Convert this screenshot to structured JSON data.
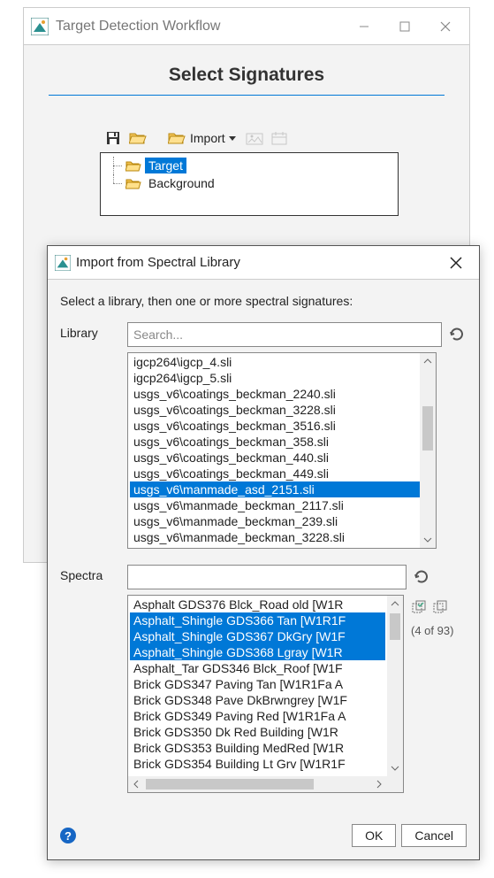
{
  "parentWindow": {
    "title": "Target Detection Workflow",
    "heading": "Select Signatures",
    "toolbar": {
      "import_label": "Import"
    },
    "tree": {
      "target": "Target",
      "background": "Background"
    }
  },
  "dialog": {
    "title": "Import from Spectral Library",
    "instruction": "Select a library, then one or more spectral signatures:",
    "library_label": "Library",
    "spectra_label": "Spectra",
    "search_placeholder": "Search...",
    "ok_label": "OK",
    "cancel_label": "Cancel",
    "counter": "(4 of 93)"
  },
  "libraryList": {
    "selected_index": 8,
    "items": [
      "igcp264\\igcp_4.sli",
      "igcp264\\igcp_5.sli",
      "usgs_v6\\coatings_beckman_2240.sli",
      "usgs_v6\\coatings_beckman_3228.sli",
      "usgs_v6\\coatings_beckman_3516.sli",
      "usgs_v6\\coatings_beckman_358.sli",
      "usgs_v6\\coatings_beckman_440.sli",
      "usgs_v6\\coatings_beckman_449.sli",
      "usgs_v6\\manmade_asd_2151.sli",
      "usgs_v6\\manmade_beckman_2117.sli",
      "usgs_v6\\manmade_beckman_239.sli",
      "usgs_v6\\manmade_beckman_3228.sli"
    ]
  },
  "spectraList": {
    "selected_indices": [
      1,
      2,
      3
    ],
    "items": [
      "Asphalt GDS376 Blck_Road old [W1R",
      "Asphalt_Shingle GDS366 Tan [W1R1F",
      "Asphalt_Shingle GDS367 DkGry [W1F",
      "Asphalt_Shingle GDS368 Lgray [W1R",
      "Asphalt_Tar GDS346 Blck_Roof [W1F",
      "Brick GDS347 Paving Tan [W1R1Fa A",
      "Brick GDS348 Pave DkBrwngrey [W1F",
      "Brick GDS349 Paving Red [W1R1Fa A",
      "Brick GDS350 Dk Red Building [W1R",
      "Brick GDS353 Building MedRed [W1R",
      "Brick GDS354 Building Lt Grv [W1R1F"
    ]
  }
}
